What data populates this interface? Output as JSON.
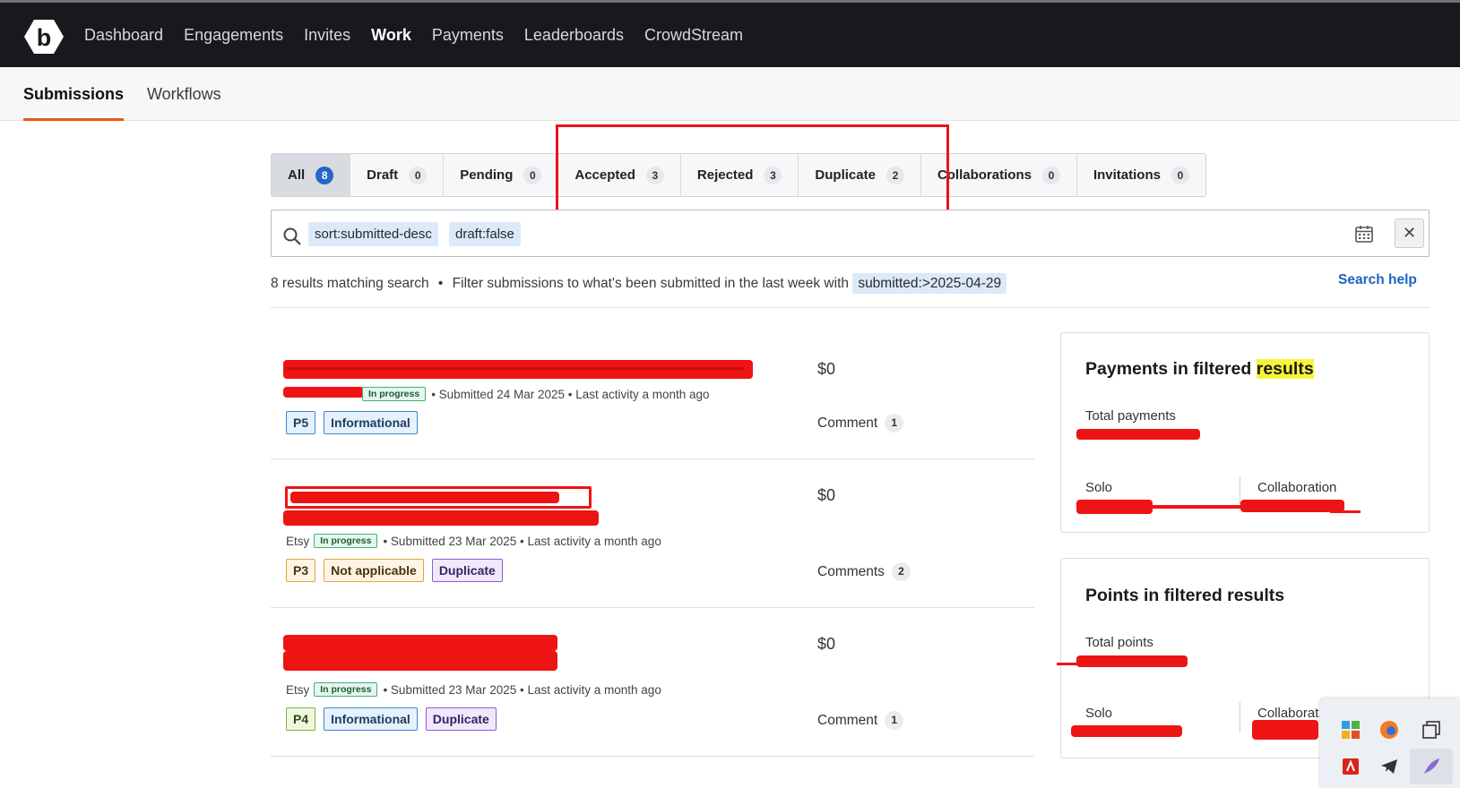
{
  "topnav": {
    "items": [
      {
        "label": "Dashboard",
        "active": false
      },
      {
        "label": "Engagements",
        "active": false
      },
      {
        "label": "Invites",
        "active": false
      },
      {
        "label": "Work",
        "active": true
      },
      {
        "label": "Payments",
        "active": false
      },
      {
        "label": "Leaderboards",
        "active": false
      },
      {
        "label": "CrowdStream",
        "active": false
      }
    ]
  },
  "subnav": {
    "tabs": [
      {
        "label": "Submissions",
        "active": true
      },
      {
        "label": "Workflows",
        "active": false
      }
    ]
  },
  "filter_tabs": [
    {
      "label": "All",
      "count": "8",
      "active": true
    },
    {
      "label": "Draft",
      "count": "0"
    },
    {
      "label": "Pending",
      "count": "0"
    },
    {
      "label": "Accepted",
      "count": "3"
    },
    {
      "label": "Rejected",
      "count": "3"
    },
    {
      "label": "Duplicate",
      "count": "2"
    },
    {
      "label": "Collaborations",
      "count": "0"
    },
    {
      "label": "Invitations",
      "count": "0"
    }
  ],
  "search": {
    "tokens": [
      "sort:submitted-desc",
      "draft:false"
    ],
    "clear_label": "✕"
  },
  "results": {
    "summary": "8 results matching search",
    "bullet": "•",
    "hint": "Filter submissions to what's been submitted in the last week with",
    "hint_token": "submitted:>2025-04-29",
    "search_help": "Search help"
  },
  "submissions": [
    {
      "program": "",
      "status": "In progress",
      "meta": "• Submitted 24 Mar 2025 • Last activity a month ago",
      "priority": "P5",
      "tags": [
        "Informational"
      ],
      "amount": "$0",
      "comments_label": "Comment",
      "comments_count": "1"
    },
    {
      "program": "Etsy",
      "status": "In progress",
      "meta": "• Submitted 23 Mar 2025 • Last activity a month ago",
      "priority": "P3",
      "tags": [
        "Not applicable",
        "Duplicate"
      ],
      "amount": "$0",
      "comments_label": "Comments",
      "comments_count": "2"
    },
    {
      "program": "Etsy",
      "status": "In progress",
      "meta": "• Submitted 23 Mar 2025 • Last activity a month ago",
      "priority": "P4",
      "tags": [
        "Informational",
        "Duplicate"
      ],
      "amount": "$0",
      "comments_label": "Comment",
      "comments_count": "1"
    }
  ],
  "payments_card": {
    "title_pre": "Payments in filtered ",
    "title_hl": "results",
    "total_label": "Total payments",
    "solo_label": "Solo",
    "collab_label": "Collaboration"
  },
  "points_card": {
    "title": "Points in filtered results",
    "total_label": "Total points",
    "solo_label": "Solo",
    "collab_label": "Collaborat"
  },
  "colors": {
    "nav_bg": "#17191c",
    "accent_orange": "#e8591a",
    "link_blue": "#1d64c0",
    "annotation_red": "#e8141c",
    "highlight_yellow": "#f5f53a"
  }
}
